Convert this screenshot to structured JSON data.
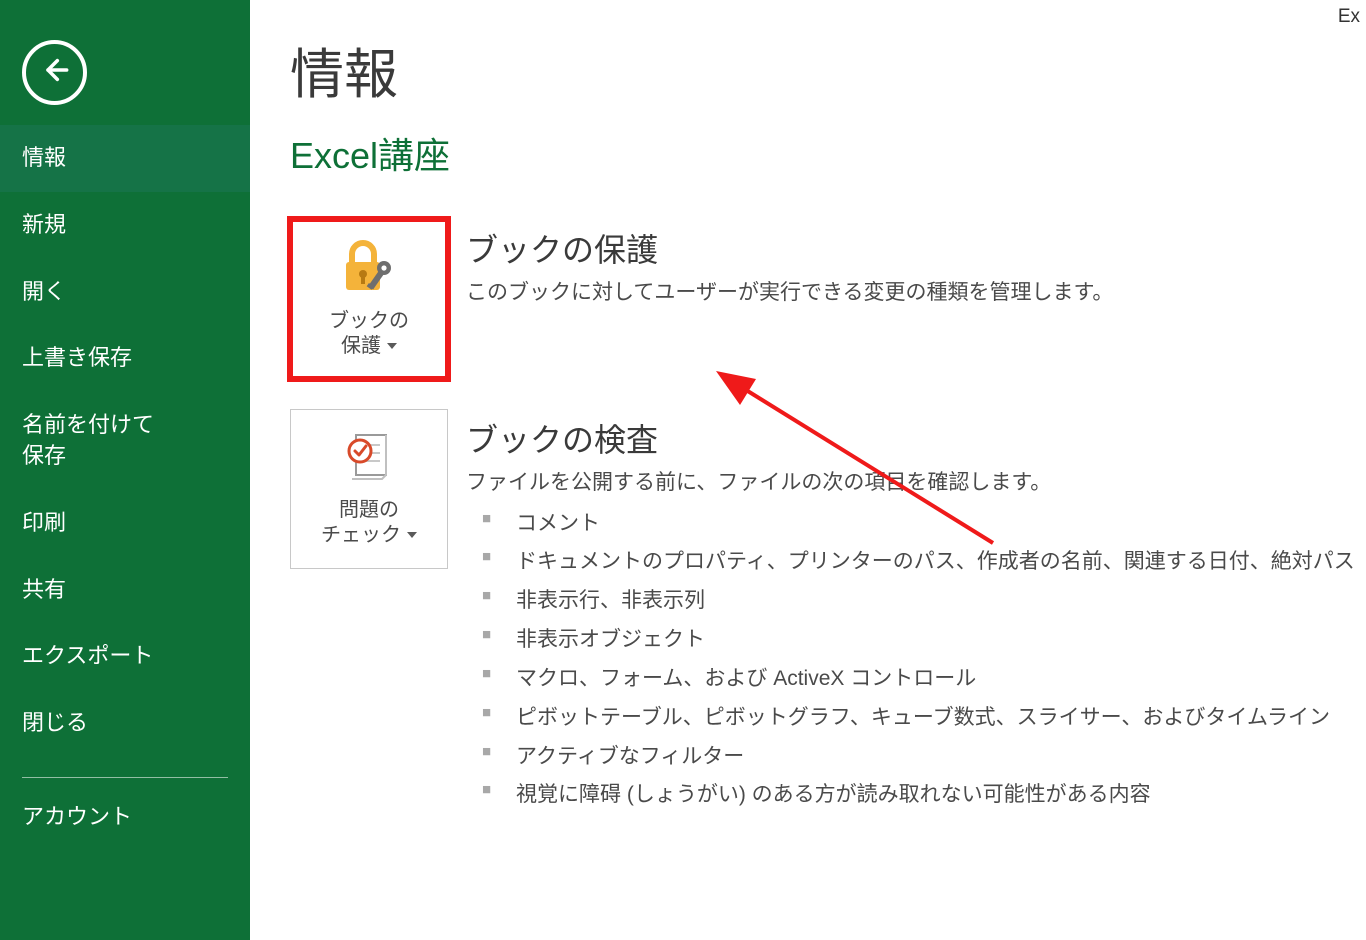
{
  "appTitle": "Ex",
  "sidebar": {
    "items": [
      {
        "label": "情報",
        "selected": true
      },
      {
        "label": "新規",
        "selected": false
      },
      {
        "label": "開く",
        "selected": false
      },
      {
        "label": "上書き保存",
        "selected": false
      },
      {
        "label": "名前を付けて\n保存",
        "selected": false
      },
      {
        "label": "印刷",
        "selected": false
      },
      {
        "label": "共有",
        "selected": false
      },
      {
        "label": "エクスポート",
        "selected": false
      },
      {
        "label": "閉じる",
        "selected": false
      }
    ],
    "footer": [
      {
        "label": "アカウント"
      }
    ]
  },
  "main": {
    "pageTitle": "情報",
    "fileName": "Excel講座",
    "sections": [
      {
        "tileLabel1": "ブックの",
        "tileLabel2": "保護",
        "heading": "ブックの保護",
        "desc": "このブックに対してユーザーが実行できる変更の種類を管理します。",
        "highlighted": true
      },
      {
        "tileLabel1": "問題の",
        "tileLabel2": "チェック",
        "heading": "ブックの検査",
        "desc": "ファイルを公開する前に、ファイルの次の項目を確認します。",
        "bullets": [
          "コメント",
          "ドキュメントのプロパティ、プリンターのパス、作成者の名前、関連する日付、絶対パス",
          "非表示行、非表示列",
          "非表示オブジェクト",
          "マクロ、フォーム、および ActiveX コントロール",
          "ピボットテーブル、ピボットグラフ、キューブ数式、スライサー、およびタイムライン",
          "アクティブなフィルター",
          "視覚に障碍 (しょうがい) のある方が読み取れない可能性がある内容"
        ]
      }
    ]
  }
}
